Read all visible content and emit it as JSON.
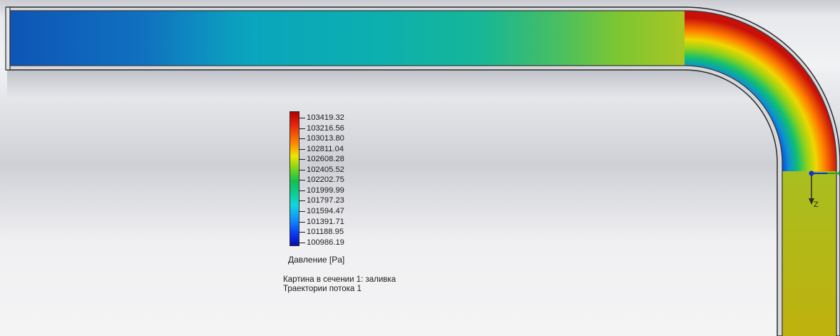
{
  "legend": {
    "ticks": [
      "103419.32",
      "103216.56",
      "103013.80",
      "102811.04",
      "102608.28",
      "102405.52",
      "102202.75",
      "101999.99",
      "101797.23",
      "101594.47",
      "101391.71",
      "101188.95",
      "100986.19"
    ],
    "title": "Давление [Pa]",
    "colors": [
      "#b00000",
      "#e31a0d",
      "#ff7a00",
      "#f2e400",
      "#71d61c",
      "#11c04f",
      "#0ccf9a",
      "#0fd7e0",
      "#0e86ff",
      "#0a2cf0",
      "#0b0fa8"
    ]
  },
  "captions": {
    "section": "Картина в сечении 1: заливка",
    "trajectories": "Траектории потока 1"
  },
  "triad": {
    "z_label": "Z"
  }
}
